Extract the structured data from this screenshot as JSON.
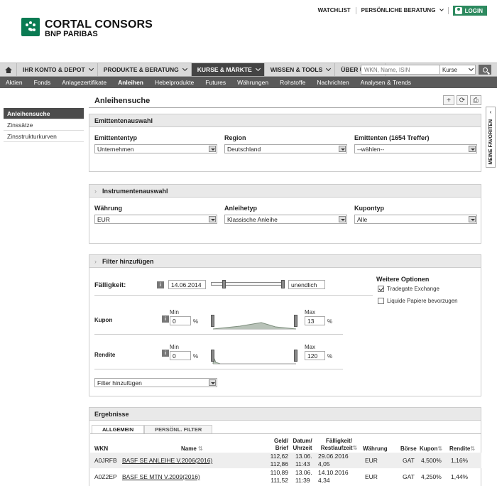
{
  "header": {
    "brand_line1": "CORTAL CONSORS",
    "brand_line2": "BNP PARIBAS",
    "links": [
      "WATCHLIST",
      "PERSÖNLICHE BERATUNG"
    ],
    "login": "LOGIN"
  },
  "mainnav": {
    "items": [
      "IHR KONTO & DEPOT",
      "PRODUKTE & BERATUNG",
      "KURSE & MÄRKTE",
      "WISSEN & TOOLS",
      "ÜBER UNS"
    ],
    "search_placeholder": "WKN, Name, ISIN",
    "search_type": "Kurse"
  },
  "subnav": {
    "items": [
      "Aktien",
      "Fonds",
      "Anlagezertifikate",
      "Anleihen",
      "Hebelprodukte",
      "Futures",
      "Währungen",
      "Rohstoffe",
      "Nachrichten",
      "Analysen & Trends"
    ]
  },
  "sidebar": {
    "items": [
      "Anleihensuche",
      "Zinssätze",
      "Zinsstrukturkurven"
    ]
  },
  "page": {
    "title": "Anleihensuche",
    "favorites": "MEINE FAVORITEN"
  },
  "emittent": {
    "title": "Emittentenauswahl",
    "typ_label": "Emittententyp",
    "typ_value": "Unternehmen",
    "region_label": "Region",
    "region_value": "Deutschland",
    "emittenten_label": "Emittenten (1654 Treffer)",
    "emittenten_value": "--wählen--"
  },
  "instrument": {
    "title": "Instrumentenauswahl",
    "waehrung_label": "Währung",
    "waehrung_value": "EUR",
    "typ_label": "Anleihetyp",
    "typ_value": "Klassische Anleihe",
    "kupon_label": "Kupontyp",
    "kupon_value": "Alle"
  },
  "filter": {
    "title": "Filter hinzufügen",
    "faelligkeit_label": "Fälligkeit:",
    "faelligkeit_from": "14.06.2014",
    "faelligkeit_to": "unendlich",
    "kupon_label": "Kupon",
    "kupon_min": "0",
    "kupon_max": "13",
    "rendite_label": "Rendite",
    "rendite_min": "0",
    "rendite_max": "120",
    "min_label": "Min",
    "max_label": "Max",
    "pct": "%",
    "add_value": "Filter hinzufügen",
    "options_title": "Weitere Optionen",
    "opt1": "Tradegate Exchange",
    "opt2": "Liquide Papiere bevorzugen",
    "opt1_checked": true,
    "opt2_checked": false
  },
  "results": {
    "title": "Ergebnisse",
    "tabs": [
      "ALLGEMEIN",
      "PERSÖNL. FILTER"
    ],
    "headers": {
      "wkn": "WKN",
      "name": "Name",
      "geld": "Geld/",
      "brief": "Brief",
      "datum": "Datum/",
      "uhrzeit": "Uhrzeit",
      "faell": "Fälligkeit/",
      "restlauf": "Restlaufzeit",
      "waehrung": "Währung",
      "boerse": "Börse",
      "kupon": "Kupon",
      "rendite": "Rendite"
    },
    "rows": [
      {
        "wkn": "A0JRFB",
        "name": "BASF SE ANLEIHE V.2006(2016)",
        "geld": "112,62",
        "brief": "112,86",
        "datum": "13.06.",
        "uhrzeit": "11:43",
        "faell": "29.06.2016",
        "rest": "4,05",
        "waehrung": "EUR",
        "boerse": "GAT",
        "kupon": "4,500%",
        "rendite": "1,16%"
      },
      {
        "wkn": "A0Z2EP",
        "name": "BASF SE MTN V.2009(2016)",
        "geld": "110,89",
        "brief": "111,52",
        "datum": "13.06.",
        "uhrzeit": "11:39",
        "faell": "14.10.2016",
        "rest": "4,34",
        "waehrung": "EUR",
        "boerse": "GAT",
        "kupon": "4,250%",
        "rendite": "1,44%"
      }
    ]
  }
}
